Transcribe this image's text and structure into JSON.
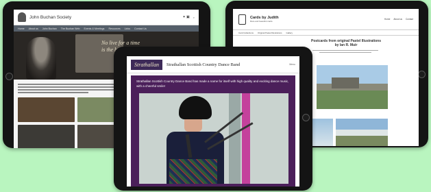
{
  "left_site": {
    "title": "John Buchan Society",
    "nav": [
      "Home",
      "About us",
      "John Buchan",
      "The Buchan Web",
      "Events & Meetings",
      "Resources",
      "Links",
      "Contact Us"
    ],
    "hero_quote": "No live for a time\nis the best kind"
  },
  "right_site": {
    "title": "Cards by Judith",
    "subtitle": "Rare and beautiful cards",
    "links": [
      "Home",
      "About us",
      "Contact"
    ],
    "nav": [
      "Card Collections",
      "Original Pastel Illustrations",
      "Gallery"
    ],
    "heading": "Postcards from original Pastel Illustrations\nby Ian R. Muir"
  },
  "front_site": {
    "logo": "Strathallan",
    "title": "Strathallan Scottish Country Dance Band",
    "menu": "Menu",
    "description": "Strathallan Scottish Country Dance Band has made a name for itself with high quality and exciting dance music, with a cheerful smile!"
  },
  "colors": {
    "background": "#b9f5bf",
    "front_accent": "#4b1f5a"
  }
}
